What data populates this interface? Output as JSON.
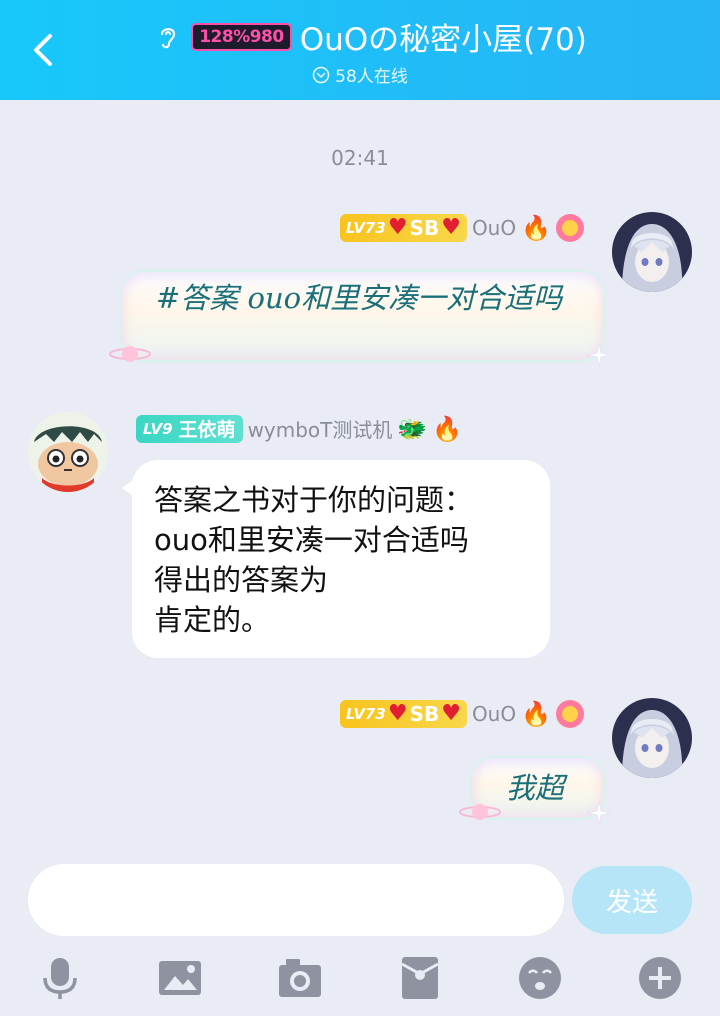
{
  "header": {
    "badge_text": "128%980",
    "title": "OuOの秘密小屋(70)",
    "online": "58人在线"
  },
  "timestamp": "02:41",
  "messages": [
    {
      "side": "right",
      "level": "LV73",
      "title_tag": "SB",
      "name": "OuO",
      "text": "#答案 ouo和里安凑一对合适吗",
      "style": "fancy"
    },
    {
      "side": "left",
      "level": "LV9",
      "title_tag": "王依萌",
      "name": "wymboT测试机",
      "lines": [
        "答案之书对于你的问题：",
        "ouo和里安凑一对合适吗",
        "得出的答案为",
        "肯定的。"
      ],
      "style": "plain"
    },
    {
      "side": "right",
      "level": "LV73",
      "title_tag": "SB",
      "name": "OuO",
      "text": "我超",
      "style": "fancy"
    }
  ],
  "input": {
    "value": "",
    "placeholder": "",
    "send_label": "发送"
  },
  "toolbar": [
    "microphone-icon",
    "image-icon",
    "camera-icon",
    "red-packet-icon",
    "emoji-icon",
    "plus-icon"
  ],
  "colors": {
    "header": "#18c8fb",
    "background": "#eaecf5",
    "send_button": "#b6e5f7",
    "level_gold": "#f9c31e",
    "level_teal": "#39d7c3"
  }
}
